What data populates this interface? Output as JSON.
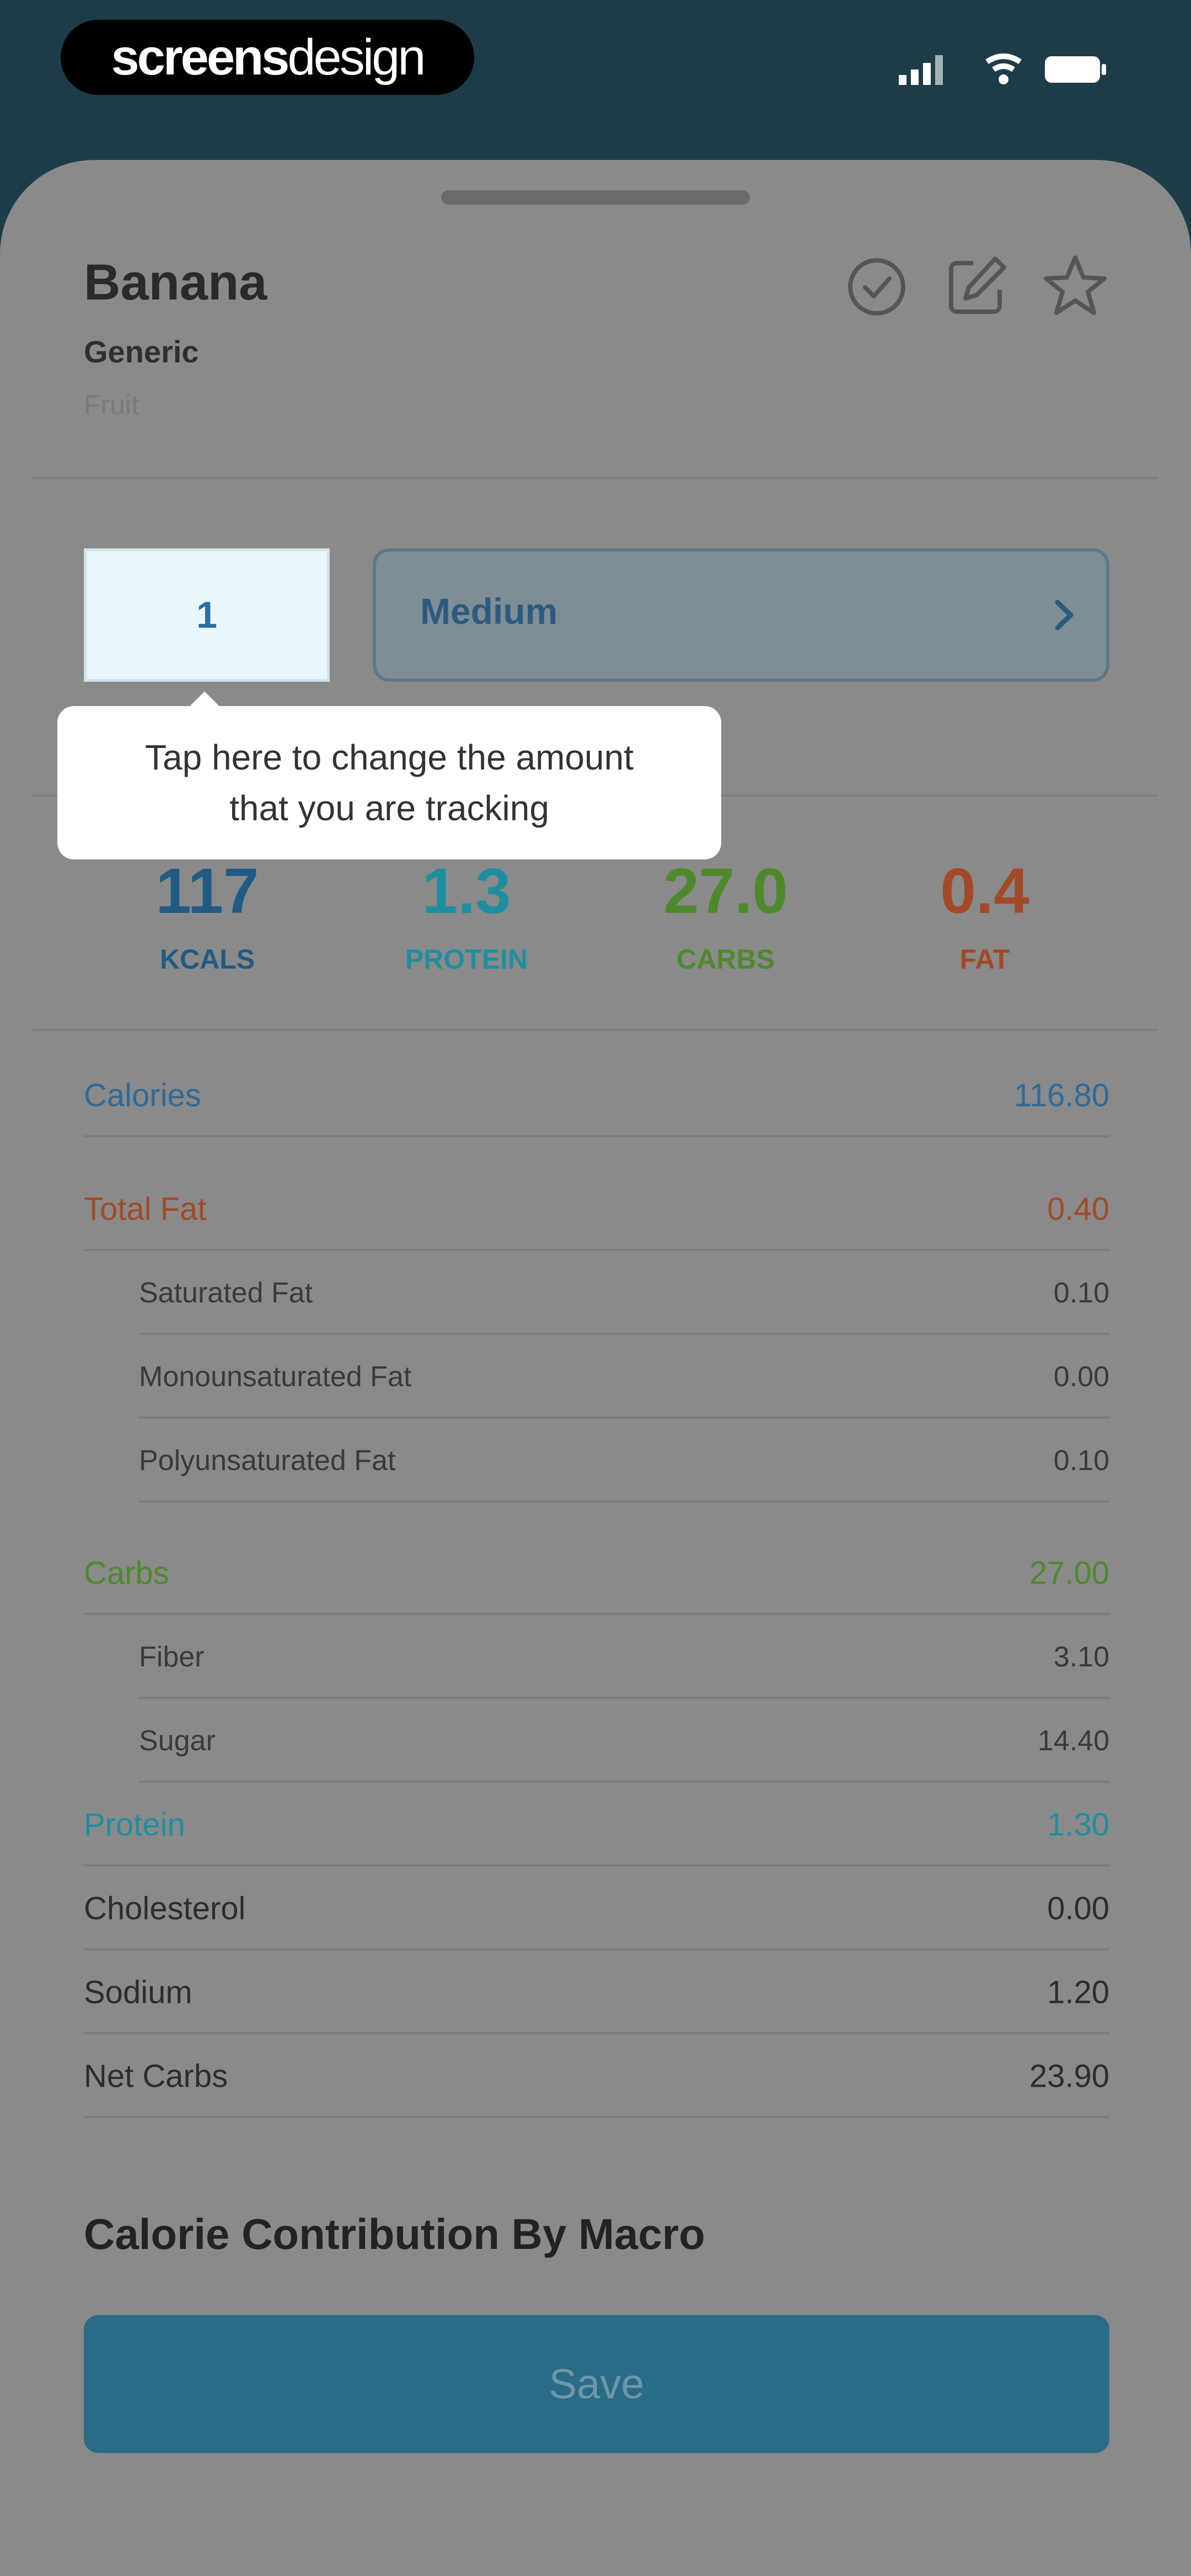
{
  "status_bar": {
    "brand_part1": "screens",
    "brand_part2": "design"
  },
  "food": {
    "name": "Banana",
    "brand": "Generic",
    "category": "Fruit"
  },
  "actions": {
    "icons": [
      "check-circle-icon",
      "edit-icon",
      "star-icon"
    ]
  },
  "serving": {
    "amount": "1",
    "size": "Medium"
  },
  "tooltip": {
    "line1": "Tap here to change the amount",
    "line2": "that you are tracking"
  },
  "macros": [
    {
      "value": "117",
      "label": "KCALS",
      "color": "#1f5b85"
    },
    {
      "value": "1.3",
      "label": "PROTEIN",
      "color": "#1e8fa1"
    },
    {
      "value": "27.0",
      "label": "CARBS",
      "color": "#4d8a2b"
    },
    {
      "value": "0.4",
      "label": "FAT",
      "color": "#a24a28"
    }
  ],
  "nutrition": [
    {
      "label": "Calories",
      "value": "116.80",
      "color": "#2f6a98",
      "sub": false
    },
    {
      "label": "Total Fat",
      "value": "0.40",
      "color": "#a24a28",
      "sub": false
    },
    {
      "label": "Saturated Fat",
      "value": "0.10",
      "color": "#3a3a3a",
      "sub": true
    },
    {
      "label": "Monounsaturated Fat",
      "value": "0.00",
      "color": "#3a3a3a",
      "sub": true
    },
    {
      "label": "Polyunsaturated Fat",
      "value": "0.10",
      "color": "#3a3a3a",
      "sub": true
    },
    {
      "label": "Carbs",
      "value": "27.00",
      "color": "#4d8a2b",
      "sub": false
    },
    {
      "label": "Fiber",
      "value": "3.10",
      "color": "#3a3a3a",
      "sub": true
    },
    {
      "label": "Sugar",
      "value": "14.40",
      "color": "#3a3a3a",
      "sub": true
    },
    {
      "label": "Protein",
      "value": "1.30",
      "color": "#1e8fa1",
      "sub": false
    },
    {
      "label": "Cholesterol",
      "value": "0.00",
      "color": "#2d2d2d",
      "sub": false
    },
    {
      "label": "Sodium",
      "value": "1.20",
      "color": "#2d2d2d",
      "sub": false
    },
    {
      "label": "Net Carbs",
      "value": "23.90",
      "color": "#2d2d2d",
      "sub": false
    }
  ],
  "section": {
    "title": "Calorie Contribution By Macro"
  },
  "save": {
    "label": "Save"
  }
}
